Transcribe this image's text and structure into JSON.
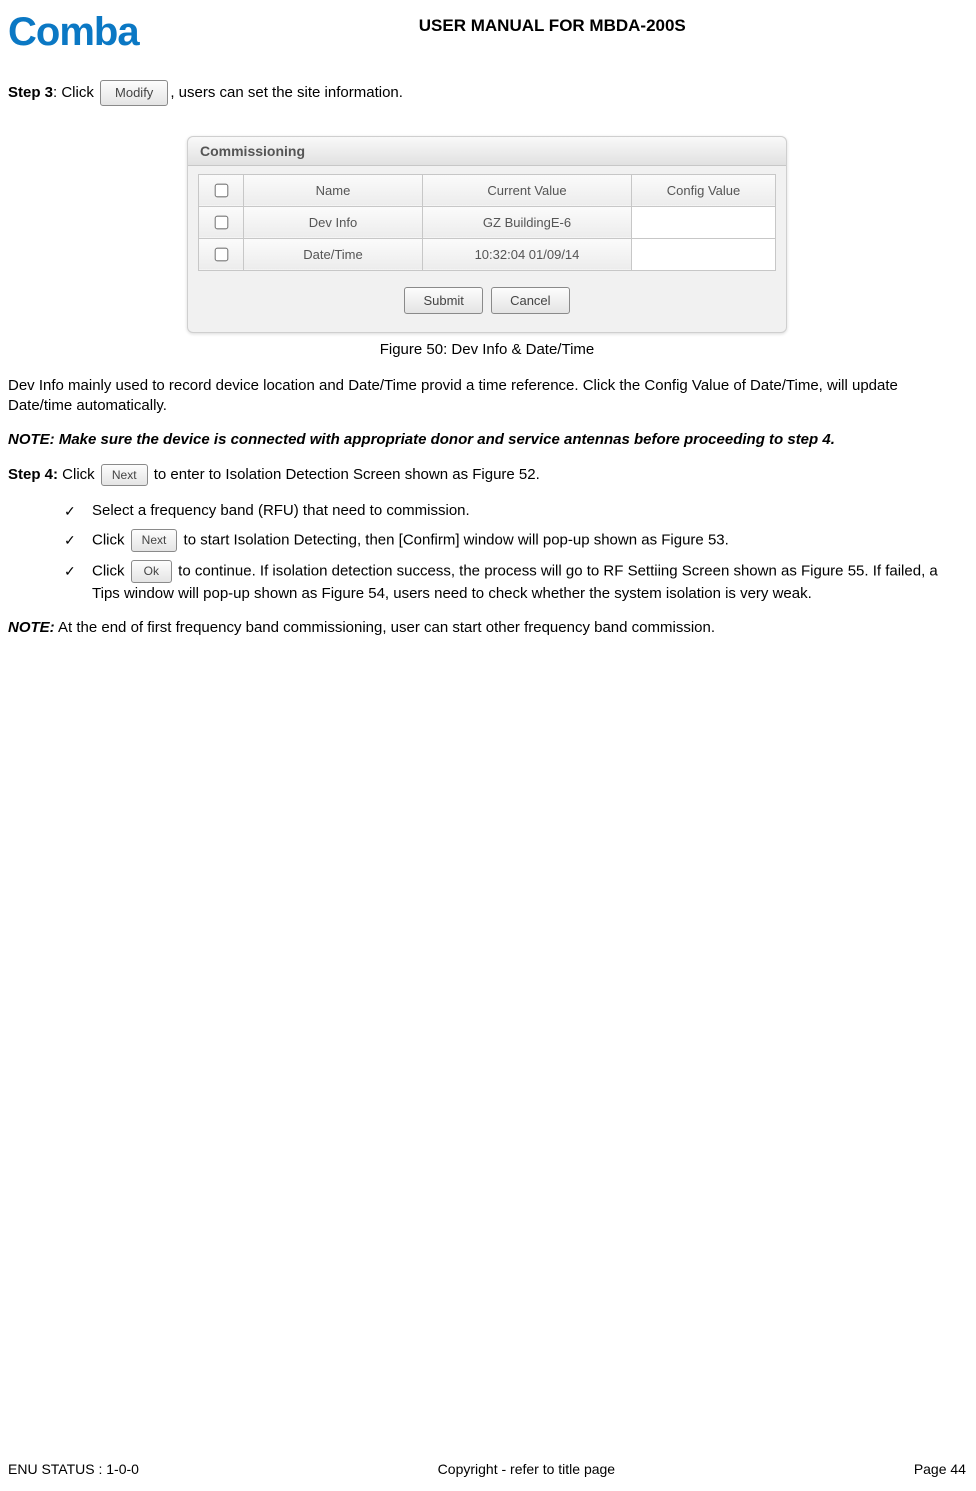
{
  "header": {
    "logo_text": "Comba",
    "doc_title": "USER MANUAL FOR MBDA-200S"
  },
  "step3": {
    "label": "Step 3",
    "pre": ": Click ",
    "btn": "Modify",
    "post": ", users can set the site information."
  },
  "panel": {
    "title": "Commissioning",
    "headers": {
      "chk": "",
      "name": "Name",
      "current": "Current Value",
      "config": "Config Value"
    },
    "rows": [
      {
        "name": "Dev Info",
        "current": "GZ BuildingE-6",
        "config": ""
      },
      {
        "name": "Date/Time",
        "current": "10:32:04 01/09/14",
        "config": ""
      }
    ],
    "submit": "Submit",
    "cancel": "Cancel"
  },
  "caption": "Figure 50: Dev Info & Date/Time",
  "para_devinfo": "Dev Info mainly used to record device location and Date/Time provid a time reference. Click the Config Value of Date/Time, will update Date/time automatically.",
  "note1": "NOTE: Make sure the device is connected with appropriate donor and service antennas before proceeding to step 4.",
  "step4": {
    "label": "Step 4:",
    "pre": " Click ",
    "btn": "Next",
    "post": " to enter to Isolation Detection Screen shown as Figure 52."
  },
  "bullets": {
    "b1": "Select a frequency band (RFU) that need to commission.",
    "b2": {
      "pre": "Click ",
      "btn": "Next",
      "post": " to start Isolation Detecting, then [Confirm] window will pop-up shown as Figure 53."
    },
    "b3": {
      "pre": "Click ",
      "btn": "Ok",
      "post": " to continue. If isolation detection success, the process will go to RF Settiing Screen shown as Figure 55. If failed, a Tips window will pop-up shown as Figure 54, users need to check whether the system isolation is very weak."
    }
  },
  "note2": {
    "lead": "NOTE:",
    "rest": " At the end of first frequency band commissioning, user can start other frequency band commission."
  },
  "footer": {
    "left": "ENU STATUS : 1-0-0",
    "center": "Copyright - refer to title page",
    "right": "Page 44"
  }
}
